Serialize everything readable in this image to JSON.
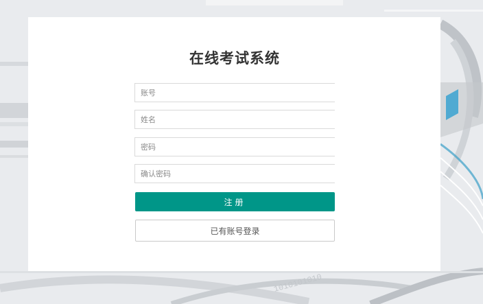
{
  "page": {
    "title": "在线考试系统"
  },
  "form": {
    "account_placeholder": "账号",
    "name_placeholder": "姓名",
    "password_placeholder": "密码",
    "confirm_password_placeholder": "确认密码",
    "register_label": "注册",
    "login_link_label": "已有账号登录"
  },
  "background": {
    "decor_text": "1010101010"
  },
  "colors": {
    "primary": "#009688",
    "panel": "#ffffff",
    "background": "#e6e8eb"
  }
}
